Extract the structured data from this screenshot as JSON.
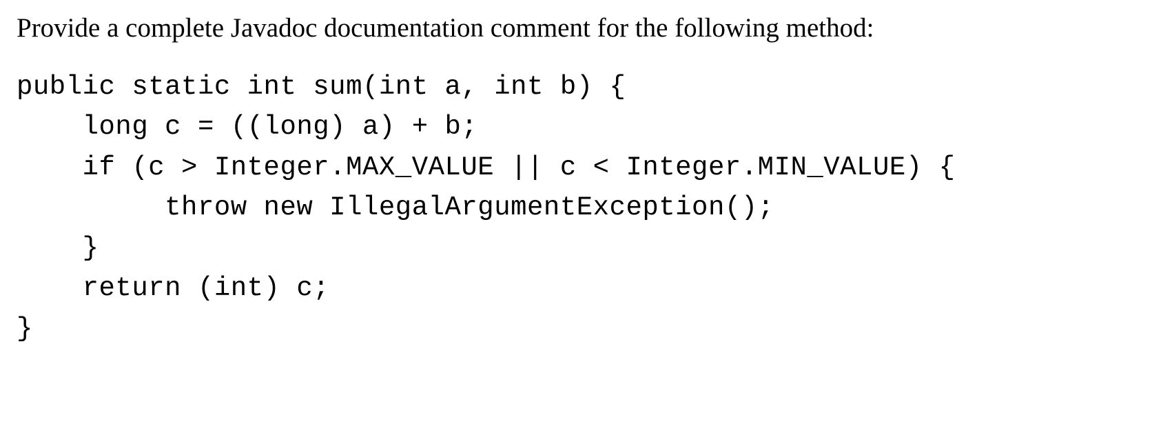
{
  "prompt": "Provide a complete Javadoc documentation comment for the following method:",
  "code": {
    "line1": "public static int sum(int a, int b) {",
    "line2": "    long c = ((long) a) + b;",
    "line3": "    if (c > Integer.MAX_VALUE || c < Integer.MIN_VALUE) {",
    "line4": "         throw new IllegalArgumentException();",
    "line5": "    }",
    "line6": "    return (int) c;",
    "line7": "}"
  }
}
